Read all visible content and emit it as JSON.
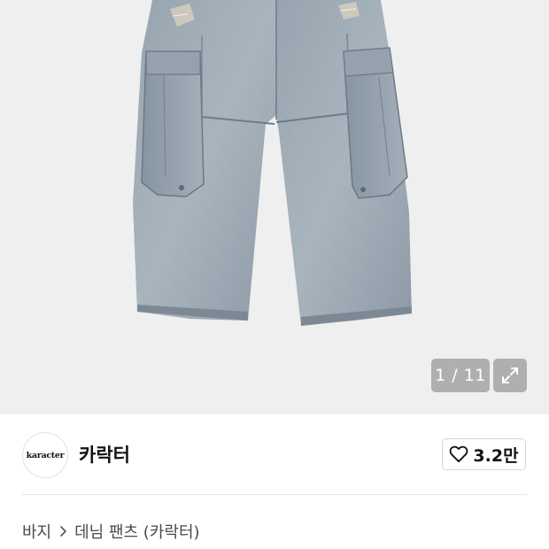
{
  "gallery": {
    "counter_text": "1 / 11",
    "expand_icon": "expand-icon",
    "background": "#efefef"
  },
  "brand": {
    "logo_text": "karacter",
    "name": "카락터"
  },
  "like": {
    "icon": "heart-outline-icon",
    "count": "3.2만"
  },
  "breadcrumb": {
    "category": "바지",
    "separator_icon": "chevron-right-icon",
    "subcategory": "데님 팬츠 (카락터)"
  }
}
